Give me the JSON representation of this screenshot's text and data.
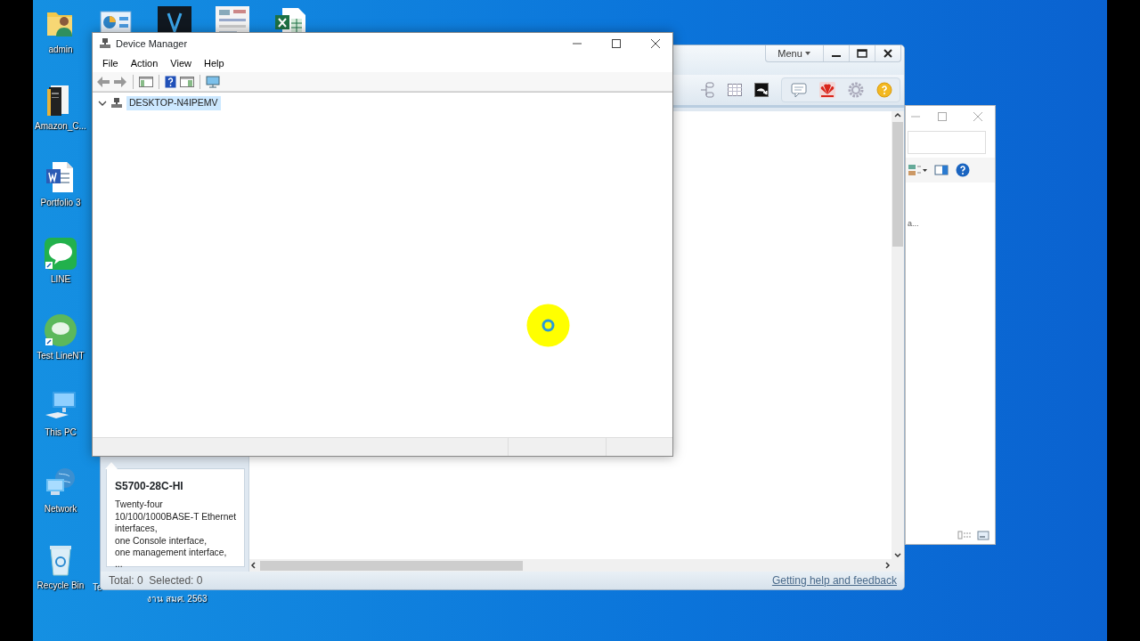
{
  "desktop_icons": [
    {
      "label": "admin",
      "kind": "user-folder"
    },
    {
      "label": "Amazon_C...",
      "kind": "book"
    },
    {
      "label": "Portfolio 3",
      "kind": "word"
    },
    {
      "label": "LINE",
      "kind": "line"
    },
    {
      "label": "Test LineNT",
      "kind": "line-round"
    },
    {
      "label": "This PC",
      "kind": "pc"
    },
    {
      "label": "Network",
      "kind": "network"
    },
    {
      "label": "Recycle Bin",
      "kind": "bin"
    }
  ],
  "top_icons": [
    {
      "kind": "chart"
    },
    {
      "kind": "video"
    },
    {
      "kind": "thumb"
    },
    {
      "kind": "excel"
    }
  ],
  "hidden_icon_label": "Te",
  "hidden_icon_label_line_2": "งาน สมศ. 2563",
  "ensp": {
    "menu_button": "Menu",
    "device_card": {
      "title": "S5700-28C-HI",
      "description": "Twenty-four\n10/100/1000BASE-T Ethernet\ninterfaces,\none Console interface,\none management interface,\n..."
    },
    "status": "Total: 0  Selected: 0",
    "help_link": "Getting help and feedback"
  },
  "explorer": {
    "partial_text": "a..."
  },
  "device_manager": {
    "title": "Device Manager",
    "menu": [
      "File",
      "Action",
      "View",
      "Help"
    ],
    "tree": [
      {
        "label": "DESKTOP-N4IPEMV",
        "expanded": true,
        "selected": true
      }
    ]
  }
}
